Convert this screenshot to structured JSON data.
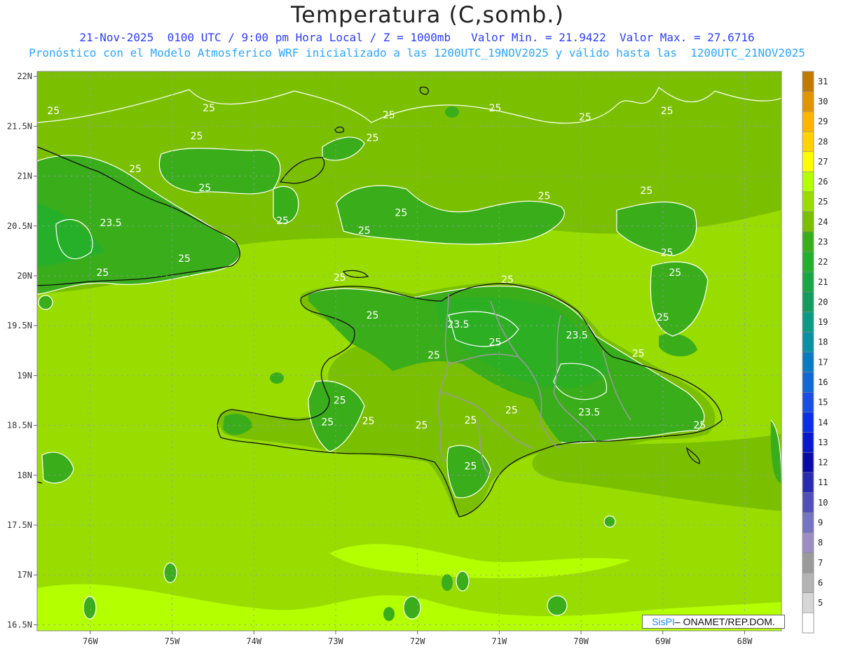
{
  "title": "Temperatura (C,somb.)",
  "subtitle1": "21-Nov-2025  0100 UTC / 9:00 pm Hora Local / Z = 1000mb   Valor Min. = 21.9422  Valor Max. = 27.6716",
  "subtitle2": "Pronóstico con el Modelo Atmosferico WRF inicializado a las 1200UTC_19NOV2025 y válido hasta las  1200UTC_21NOV2025",
  "credit_brand": "SisPI",
  "credit_text": " – ONAMET/REP.DOM.",
  "lat_labels": [
    "22N",
    "21.5N",
    "21N",
    "20.5N",
    "20N",
    "19.5N",
    "19N",
    "18.5N",
    "18N",
    "17.5N",
    "17N",
    "16.5N"
  ],
  "lon_labels": [
    "76W",
    "75W",
    "74W",
    "73W",
    "72W",
    "71W",
    "70W",
    "69W",
    "68W"
  ],
  "contour_labels": [
    {
      "text": "25",
      "lon": -76.45,
      "lat": 21.62
    },
    {
      "text": "25",
      "lon": -74.55,
      "lat": 21.65
    },
    {
      "text": "25",
      "lon": -72.35,
      "lat": 21.58
    },
    {
      "text": "25",
      "lon": -71.05,
      "lat": 21.65
    },
    {
      "text": "25",
      "lon": -69.95,
      "lat": 21.56
    },
    {
      "text": "25",
      "lon": -68.95,
      "lat": 21.62
    },
    {
      "text": "25",
      "lon": -74.7,
      "lat": 21.37
    },
    {
      "text": "25",
      "lon": -72.55,
      "lat": 21.35
    },
    {
      "text": "25",
      "lon": -75.45,
      "lat": 21.04
    },
    {
      "text": "25",
      "lon": -74.6,
      "lat": 20.85
    },
    {
      "text": "25",
      "lon": -73.65,
      "lat": 20.52
    },
    {
      "text": "23.5",
      "lon": -75.75,
      "lat": 20.5
    },
    {
      "text": "25",
      "lon": -72.2,
      "lat": 20.6
    },
    {
      "text": "25",
      "lon": -72.65,
      "lat": 20.42
    },
    {
      "text": "25",
      "lon": -70.45,
      "lat": 20.77
    },
    {
      "text": "25",
      "lon": -69.2,
      "lat": 20.82
    },
    {
      "text": "25",
      "lon": -74.85,
      "lat": 20.14
    },
    {
      "text": "25",
      "lon": -75.85,
      "lat": 20.0
    },
    {
      "text": "25",
      "lon": -68.95,
      "lat": 20.2
    },
    {
      "text": "25",
      "lon": -72.95,
      "lat": 19.95
    },
    {
      "text": "25",
      "lon": -70.9,
      "lat": 19.93
    },
    {
      "text": "25",
      "lon": -68.85,
      "lat": 20.0
    },
    {
      "text": "25",
      "lon": -72.55,
      "lat": 19.57
    },
    {
      "text": "23.5",
      "lon": -71.5,
      "lat": 19.48
    },
    {
      "text": "25",
      "lon": -69.0,
      "lat": 19.55
    },
    {
      "text": "23.5",
      "lon": -70.05,
      "lat": 19.37
    },
    {
      "text": "25",
      "lon": -71.05,
      "lat": 19.3
    },
    {
      "text": "25",
      "lon": -71.8,
      "lat": 19.17
    },
    {
      "text": "25",
      "lon": -69.3,
      "lat": 19.19
    },
    {
      "text": "25",
      "lon": -72.95,
      "lat": 18.72
    },
    {
      "text": "25",
      "lon": -70.85,
      "lat": 18.62
    },
    {
      "text": "23.5",
      "lon": -69.9,
      "lat": 18.6
    },
    {
      "text": "25",
      "lon": -73.1,
      "lat": 18.5
    },
    {
      "text": "25",
      "lon": -72.6,
      "lat": 18.51
    },
    {
      "text": "25",
      "lon": -71.95,
      "lat": 18.47
    },
    {
      "text": "25",
      "lon": -71.35,
      "lat": 18.52
    },
    {
      "text": "25",
      "lon": -68.55,
      "lat": 18.47
    },
    {
      "text": "25",
      "lon": -71.35,
      "lat": 18.06
    }
  ],
  "colorbar": {
    "tick_labels": [
      "31",
      "30",
      "29",
      "28",
      "27",
      "26",
      "25",
      "24",
      "23",
      "22",
      "21",
      "20",
      "19",
      "18",
      "17",
      "16",
      "15",
      "14",
      "13",
      "12",
      "11",
      "10",
      "9",
      "8",
      "7",
      "6",
      "5"
    ],
    "colors": [
      "#c07a00",
      "#e09500",
      "#ffb400",
      "#ffd200",
      "#fffc00",
      "#b4ff00",
      "#99dd00",
      "#7bc000",
      "#3aad1a",
      "#22b02e",
      "#1ba646",
      "#139c5e",
      "#0c9a84",
      "#0a8fa4",
      "#0a7ac2",
      "#1167d6",
      "#1a4de3",
      "#0c2ee5",
      "#0a18cc",
      "#0a0aa8",
      "#2a2ab0",
      "#5050b8",
      "#7474c0",
      "#9c8cc4",
      "#9a9a9a",
      "#b4b4b4",
      "#d6d6d6",
      "#ffffff"
    ]
  },
  "legend_note_colors": {
    "lowland": "#b4ff00",
    "mid": "#99dd00",
    "base": "#7bc000",
    "high": "#3aad1a"
  }
}
